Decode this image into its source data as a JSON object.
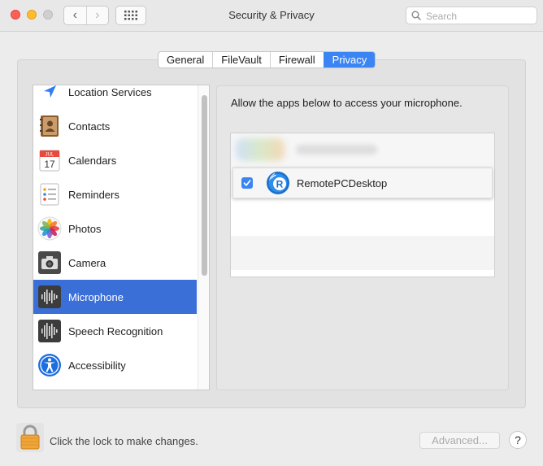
{
  "window": {
    "title": "Security & Privacy"
  },
  "toolbar": {
    "back": "‹",
    "forward": "›"
  },
  "search": {
    "placeholder": "Search"
  },
  "tabs": [
    {
      "label": "General"
    },
    {
      "label": "FileVault"
    },
    {
      "label": "Firewall"
    },
    {
      "label": "Privacy"
    }
  ],
  "sidebar": {
    "items": [
      {
        "label": "Location Services",
        "icon": "location-arrow-icon"
      },
      {
        "label": "Contacts",
        "icon": "contacts-book-icon"
      },
      {
        "label": "Calendars",
        "icon": "calendar-icon",
        "day": "17",
        "month": "JUL"
      },
      {
        "label": "Reminders",
        "icon": "reminders-list-icon"
      },
      {
        "label": "Photos",
        "icon": "photos-flower-icon"
      },
      {
        "label": "Camera",
        "icon": "camera-icon"
      },
      {
        "label": "Microphone",
        "icon": "microphone-waveform-icon",
        "selected": true
      },
      {
        "label": "Speech Recognition",
        "icon": "speech-waveform-icon"
      },
      {
        "label": "Accessibility",
        "icon": "accessibility-person-icon"
      }
    ]
  },
  "main": {
    "description": "Allow the apps below to access your microphone.",
    "apps": [
      {
        "name": "RemotePCDesktop",
        "checked": true,
        "icon": "remotepc-r-icon"
      }
    ]
  },
  "footer": {
    "lock_text": "Click the lock to make changes.",
    "advanced_label": "Advanced...",
    "help_label": "?"
  },
  "colors": {
    "accent": "#3a85f3",
    "selected_row": "#3a6fd8"
  }
}
